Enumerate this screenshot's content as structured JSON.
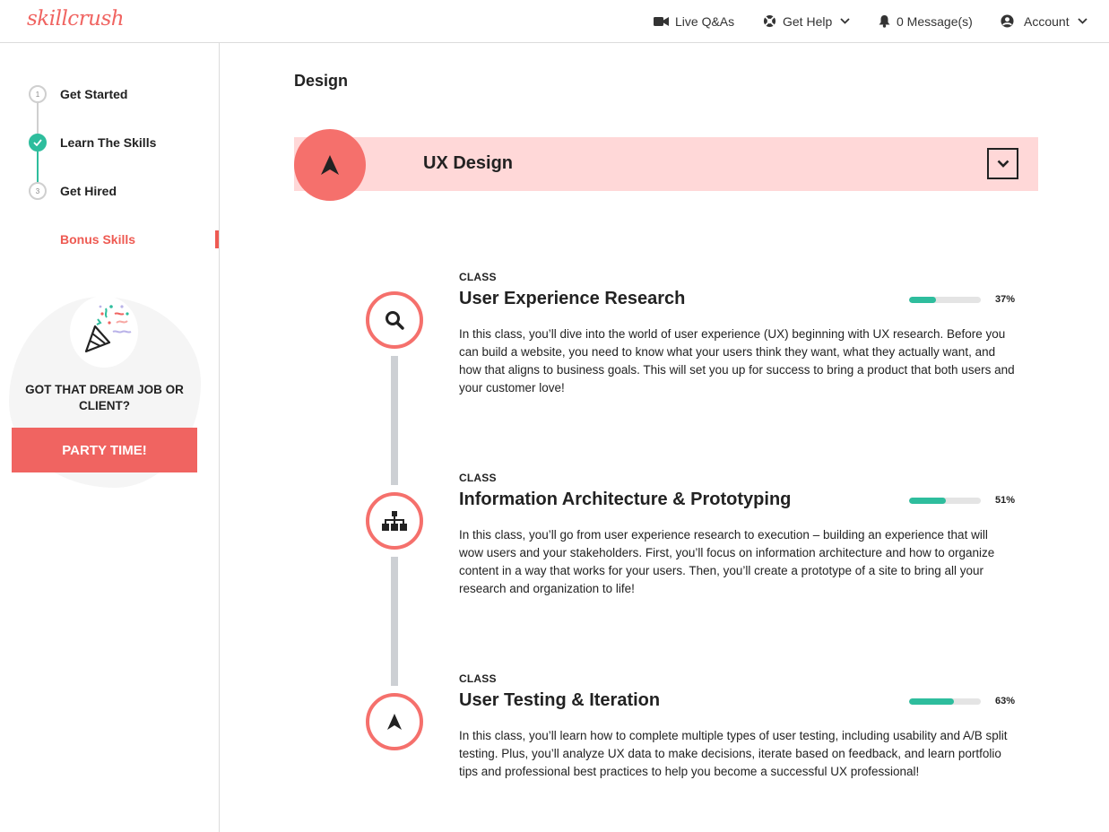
{
  "header": {
    "logo": "skillcrush",
    "nav": [
      {
        "label": "Live Q&As",
        "icon": "video-camera-icon"
      },
      {
        "label": "Get Help",
        "icon": "lifebuoy-icon",
        "dropdown": true
      },
      {
        "label": "0 Message(s)",
        "icon": "bell-icon"
      },
      {
        "label": "Account",
        "icon": "user-circle-icon",
        "dropdown": true
      }
    ]
  },
  "sidebar": {
    "steps": [
      {
        "number": "1",
        "label": "Get Started",
        "status": "upcoming"
      },
      {
        "number": "",
        "label": "Learn The Skills",
        "status": "completed"
      },
      {
        "number": "3",
        "label": "Get Hired",
        "status": "upcoming"
      }
    ],
    "bonus": "Bonus Skills",
    "party": {
      "text": "GOT THAT DREAM JOB OR CLIENT?",
      "button": "PARTY TIME!",
      "icon": "party-popper-icon"
    }
  },
  "main": {
    "section_title": "Design",
    "track": {
      "title": "UX Design",
      "icon": "navigation-arrow-icon",
      "toggle_icon": "chevron-down-icon"
    },
    "classes": [
      {
        "kicker": "CLASS",
        "title": "User Experience Research",
        "progress": 37,
        "progress_label": "37%",
        "icon": "search-icon",
        "description": "In this class, you’ll dive into the world of user experience (UX) beginning with UX research. Before you can build a website, you need to know what your users think they want, what they actually want, and how that aligns to business goals. This will set you up for success to bring a product that both users and your customer love!"
      },
      {
        "kicker": "CLASS",
        "title": "Information Architecture & Prototyping",
        "progress": 51,
        "progress_label": "51%",
        "icon": "sitemap-icon",
        "description": "In this class, you’ll go from user experience research to execution – building an experience that will wow users and your stakeholders. First, you’ll focus on information architecture and how to organize content in a way that works for your users. Then, you’ll create a prototype of a site to bring all your research and organization to life!"
      },
      {
        "kicker": "CLASS",
        "title": "User Testing & Iteration",
        "progress": 63,
        "progress_label": "63%",
        "icon": "navigation-arrow-icon",
        "description": "In this class, you’ll learn how to complete multiple types of user testing, including usability and A/B split testing. Plus, you’ll analyze UX data to make decisions, iterate based on feedback, and learn portfolio tips and professional best practices to help you become a successful UX professional!"
      }
    ]
  },
  "colors": {
    "brand": "#f06461",
    "banner_bg": "#ffd8d8",
    "progress": "#2ebd9d",
    "timeline": "#cdd0d4"
  }
}
